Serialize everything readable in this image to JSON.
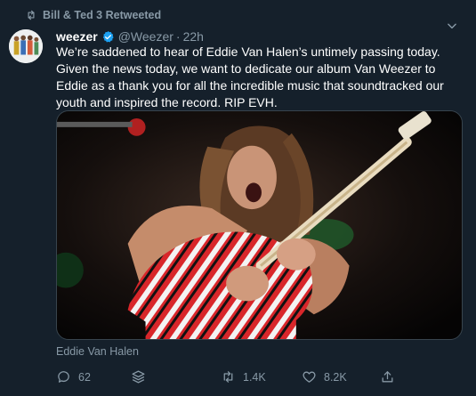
{
  "retweet_context": {
    "text": "Bill & Ted 3 Retweeted",
    "icon": "retweet-icon"
  },
  "author": {
    "name": "weezer",
    "handle": "@Weezer",
    "separator": "·",
    "time": "22h",
    "verified": true
  },
  "tweet": {
    "text": "We’re saddened to hear of Eddie Van Halen’s untimely passing today.  Given the news today, we want to dedicate our album Van Weezer to Eddie as a thank you for all the incredible music that soundtracked our youth and inspired the record.  RIP EVH."
  },
  "media": {
    "caption": "Eddie Van Halen"
  },
  "actions": {
    "reply_count": "62",
    "retweet_count": "1.4K",
    "like_count": "8.2K"
  },
  "colors": {
    "background": "#15202b",
    "secondary_text": "#8899a6",
    "verified_blue": "#1da1f2"
  }
}
